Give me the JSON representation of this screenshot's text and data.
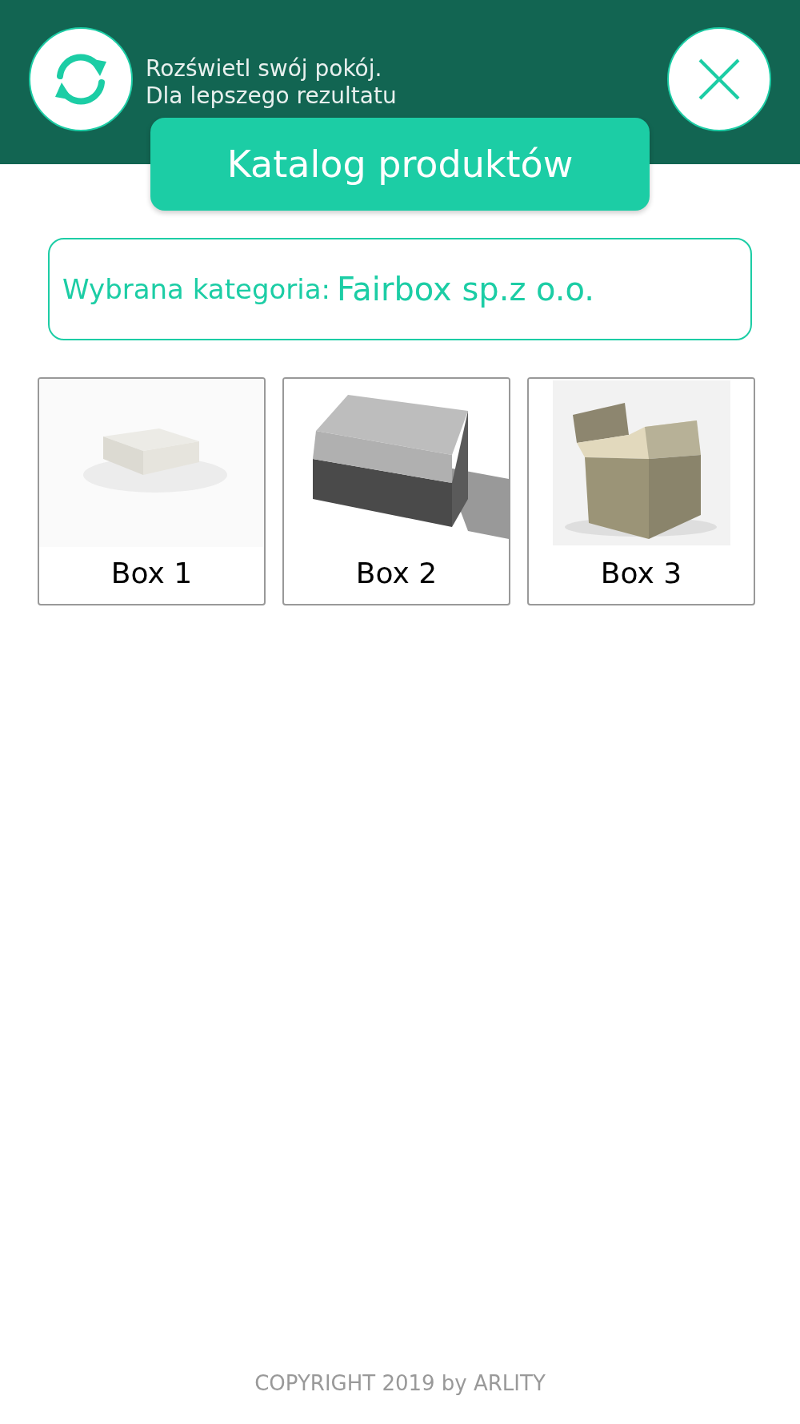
{
  "header": {
    "message_lines": [
      "Rozświetl swój pokój.",
      "Dla lepszego rezultatu"
    ]
  },
  "catalog_button": {
    "label": "Katalog produktów"
  },
  "category": {
    "label": "Wybrana kategoria:",
    "value": "Fairbox sp.z o.o."
  },
  "products": [
    {
      "name": "Box 1"
    },
    {
      "name": "Box 2"
    },
    {
      "name": "Box 3"
    }
  ],
  "footer": {
    "copyright": "COPYRIGHT 2019 by ARLITY"
  }
}
